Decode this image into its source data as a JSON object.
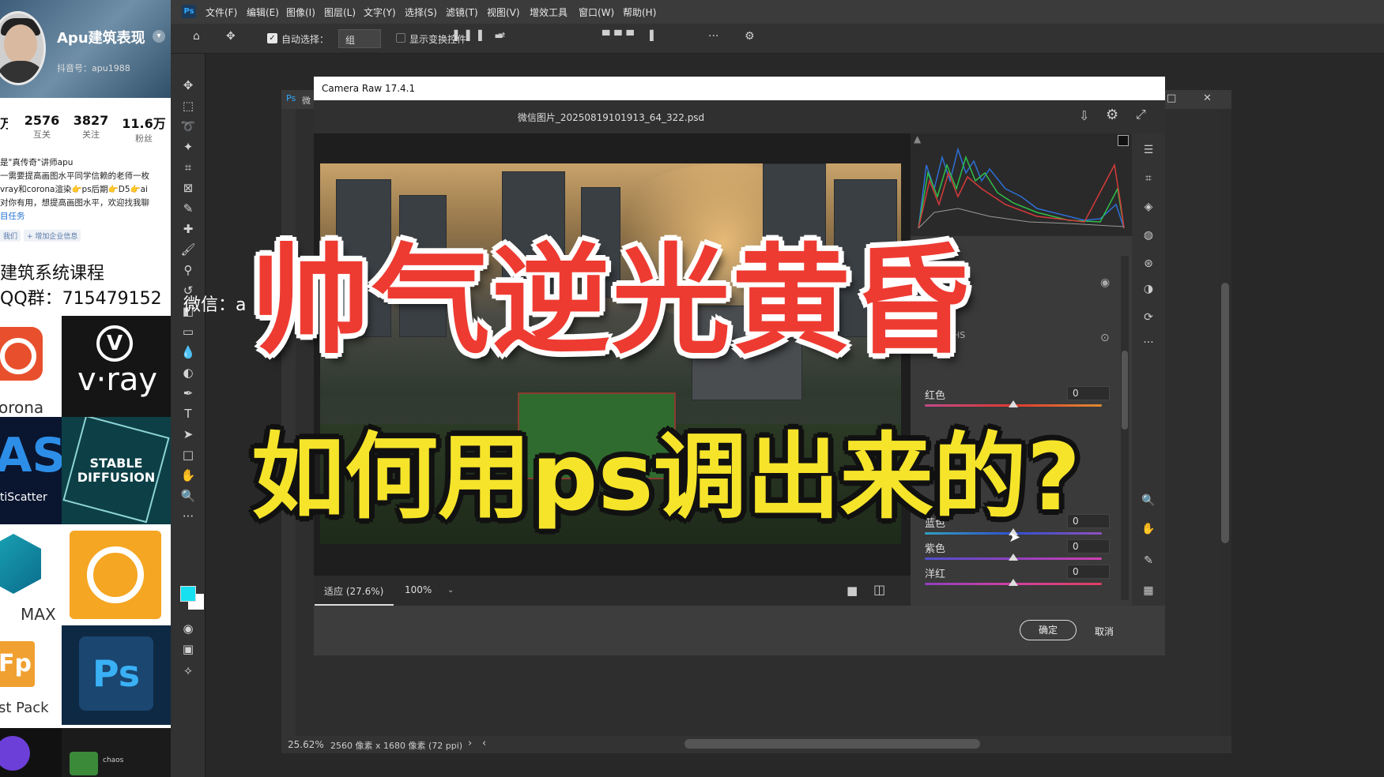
{
  "profile": {
    "name": "Apu建筑表现",
    "dropdown": "▾",
    "douyin_id": "抖音号：apu1988",
    "stats": [
      {
        "value": "2576",
        "label": "互关"
      },
      {
        "value": "3827",
        "label": "关注"
      },
      {
        "value": "11.6万",
        "label": "粉丝"
      }
    ],
    "stat_partial": "万",
    "bio": [
      "是\"真传奇\"讲师apu",
      "一需要提高画图水平同学信赖的老师一枚",
      "vray和corona渲染👉ps后期👉D5👉ai",
      "对你有用，想提高画图水平，欢迎找我聊",
      "目任务"
    ],
    "tags": [
      "我们",
      "+ 增加企业信息"
    ],
    "course": "建筑系统课程",
    "qq": "QQ群：715479152",
    "tiles": {
      "corona": "orona",
      "vray_v": "V",
      "vray": "v·ray",
      "ms": "AS",
      "ms_label": "ltiScatter",
      "sd": "STABLE DIFFUSION",
      "max": "MAX",
      "fp": "Fp",
      "fp_label": "st Pack",
      "ps": "Ps",
      "bot2": "chaos"
    }
  },
  "ps": {
    "logo": "Ps",
    "menu": [
      "文件(F)",
      "编辑(E)",
      "图像(I)",
      "图层(L)",
      "文字(Y)",
      "选择(S)",
      "滤镜(T)",
      "视图(V)",
      "增效工具",
      "窗口(W)",
      "帮助(H)"
    ],
    "options": {
      "auto_select": "自动选择：",
      "group": "组",
      "show_transform": "显示变换控件"
    },
    "status": {
      "zoom": "25.62%",
      "size": "2560 像素 x 1680 像素 (72 ppi)",
      "doc_tab": "微"
    }
  },
  "camera_raw": {
    "title": "Camera Raw 17.4.1",
    "file": "微信图片_20250819101913_64_322.psd",
    "zoom_fit": "适应 (27.6%)",
    "zoom_100": "100%",
    "hsl": [
      {
        "label": "红色",
        "value": "0",
        "track": "linear-gradient(90deg,#c04a8a,#e03a30,#e08a30)"
      },
      {
        "label": "蓝色",
        "value": "0",
        "track": "linear-gradient(90deg,#30a0c0,#3050d0,#9050c0)"
      },
      {
        "label": "紫色",
        "value": "0",
        "track": "linear-gradient(90deg,#5050d0,#9040c0,#d040b0)"
      },
      {
        "label": "洋红",
        "value": "0",
        "track": "linear-gradient(90deg,#9040c0,#d040a0,#e04060)"
      }
    ],
    "ok": "确定",
    "cancel": "取消",
    "panel_hint": "HS"
  },
  "overlay": {
    "wechat": "微信：a",
    "headline1": "帅气逆光黄昏",
    "headline2": "如何用ps调出来的?"
  },
  "colors": {
    "headline1": "#ee3b32",
    "headline2": "#f6e42a",
    "fg_swatch": "#17e0f0"
  }
}
